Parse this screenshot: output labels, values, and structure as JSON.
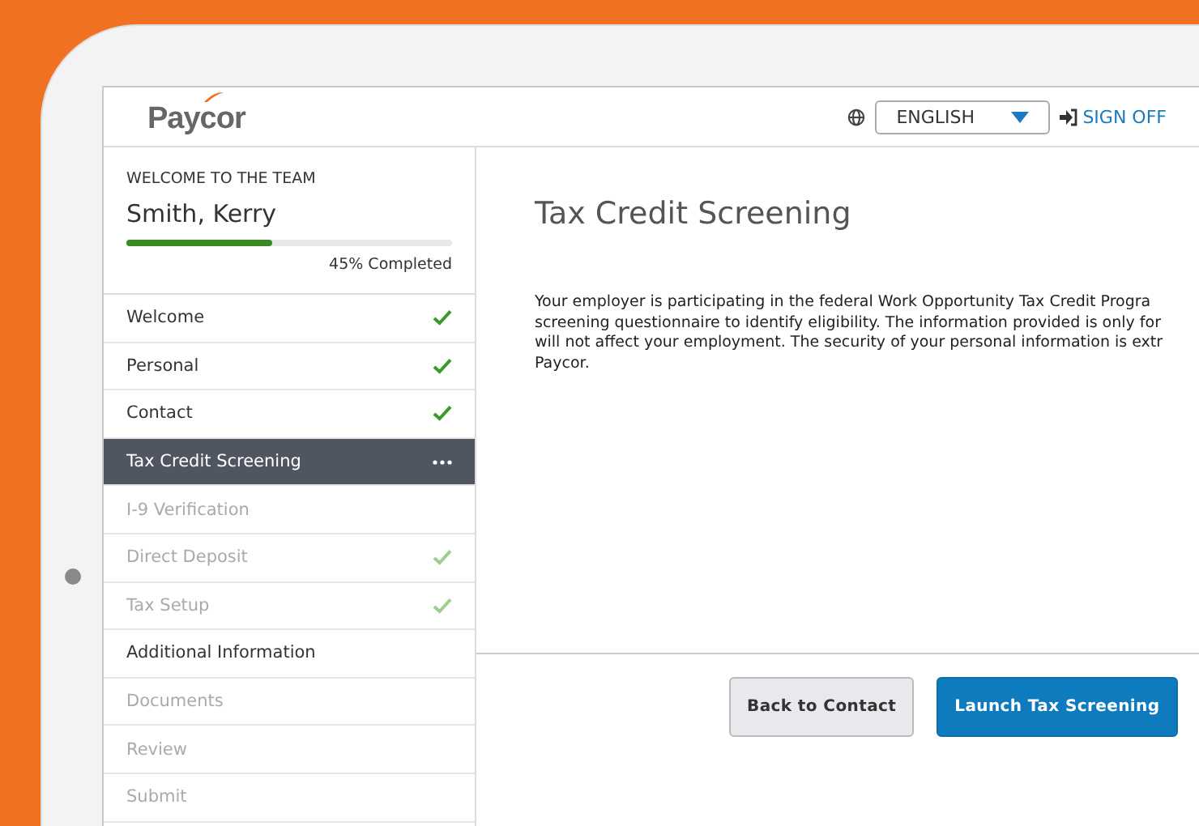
{
  "header": {
    "logo": "Paycor",
    "language": "ENGLISH",
    "sign_off": "SIGN OFF"
  },
  "sidebar": {
    "greeting": "WELCOME TO THE TEAM",
    "name": "Smith, Kerry",
    "progress": {
      "level": 0.45,
      "label": "45% Completed"
    },
    "items": [
      {
        "label": "Welcome",
        "selected": false,
        "disabled": false,
        "checked": true
      },
      {
        "label": "Personal",
        "selected": false,
        "disabled": false,
        "checked": true
      },
      {
        "label": "Contact",
        "selected": false,
        "disabled": false,
        "checked": true
      },
      {
        "label": "Tax Credit Screening",
        "selected": true,
        "disabled": false,
        "checked": false
      },
      {
        "label": "I-9 Verification",
        "selected": false,
        "disabled": true,
        "checked": false
      },
      {
        "label": "Direct Deposit",
        "selected": false,
        "disabled": true,
        "checked": true
      },
      {
        "label": "Tax Setup",
        "selected": false,
        "disabled": true,
        "checked": true
      },
      {
        "label": "Additional Information",
        "selected": false,
        "disabled": false,
        "checked": false
      },
      {
        "label": "Documents",
        "selected": false,
        "disabled": true,
        "checked": false
      },
      {
        "label": "Review",
        "selected": false,
        "disabled": true,
        "checked": false
      },
      {
        "label": "Submit",
        "selected": false,
        "disabled": true,
        "checked": false
      }
    ]
  },
  "content": {
    "title": "Tax Credit Screening",
    "paragraph_lines": [
      "Your employer is participating in the federal Work Opportunity Tax Credit Progra",
      "screening questionnaire to identify eligibility. The information provided is only for",
      "will not affect your employment. The security of your personal information is extr",
      "Paycor."
    ],
    "buttons": [
      {
        "label": "Back to Contact",
        "kind": "secondary"
      },
      {
        "label": "Launch Tax Screening",
        "kind": "primary"
      }
    ]
  }
}
